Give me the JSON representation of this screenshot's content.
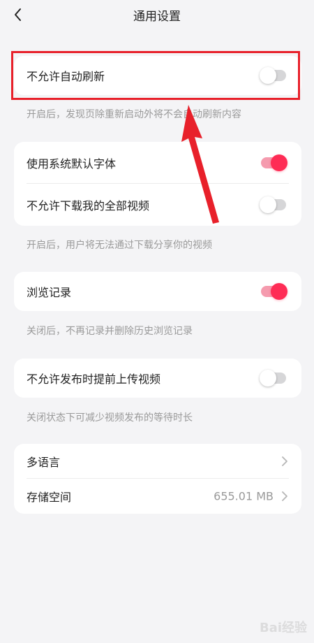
{
  "header": {
    "title": "通用设置",
    "back_icon": "chevron-left-icon"
  },
  "sections": [
    {
      "rows": [
        {
          "label": "不允许自动刷新",
          "toggle": "off"
        }
      ],
      "note": "开启后，发现页除重新启动外将不会自动刷新内容"
    },
    {
      "rows": [
        {
          "label": "使用系统默认字体",
          "toggle": "on"
        },
        {
          "label": "不允许下载我的全部视频",
          "toggle": "off"
        }
      ],
      "note": "开启后，用户将无法通过下载分享你的视频"
    },
    {
      "rows": [
        {
          "label": "浏览记录",
          "toggle": "on"
        }
      ],
      "note": "关闭后，不再记录并删除历史浏览记录"
    },
    {
      "rows": [
        {
          "label": "不允许发布时提前上传视频",
          "toggle": "off"
        }
      ],
      "note": "关闭状态下可减少视频发布的等待时长"
    },
    {
      "rows": [
        {
          "label": "多语言",
          "value": ""
        },
        {
          "label": "存储空间",
          "value": "655.01 MB"
        }
      ]
    }
  ],
  "colors": {
    "accent": "#fe2c55",
    "accent_track": "#f59bae",
    "annotation": "#e8202a"
  },
  "watermark": "Bai经验"
}
